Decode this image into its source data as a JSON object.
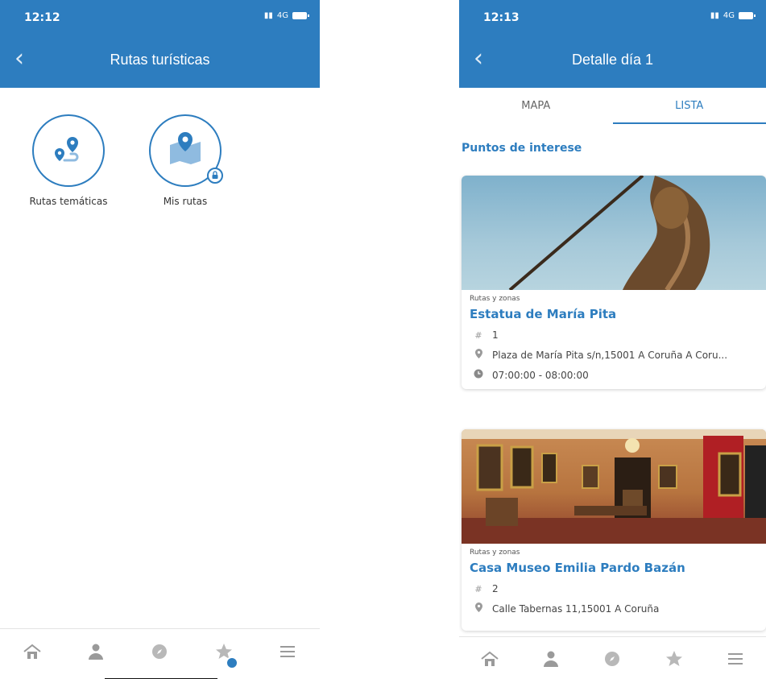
{
  "colors": {
    "primary": "#2d7dbf",
    "icon_gray": "#9a9a9a"
  },
  "screen1": {
    "status": {
      "time": "12:12",
      "network": "4G"
    },
    "header": {
      "title": "Rutas turísticas",
      "back_icon": "chevron-left-icon"
    },
    "tiles": [
      {
        "label": "Rutas temáticas",
        "icon": "route-pins-icon"
      },
      {
        "label": "Mis rutas",
        "icon": "map-pin-icon",
        "badge_icon": "lock-icon"
      }
    ],
    "tabbar": [
      "home-icon",
      "user-icon",
      "compass-icon",
      "star-icon",
      "menu-icon"
    ]
  },
  "screen2": {
    "status": {
      "time": "12:13",
      "network": "4G"
    },
    "header": {
      "title": "Detalle día 1",
      "back_icon": "chevron-left-icon"
    },
    "tabs": [
      {
        "label": "MAPA",
        "active": false
      },
      {
        "label": "LISTA",
        "active": true
      }
    ],
    "section_title": "Puntos de interese",
    "cards": [
      {
        "category": "Rutas y zonas",
        "name": "Estatua de María Pita",
        "number": "1",
        "address": "Plaza de María Pita s/n,15001 A Coruña A Coru...",
        "hours": "07:00:00 - 08:00:00"
      },
      {
        "category": "Rutas y zonas",
        "name": "Casa Museo Emilia Pardo Bazán",
        "number": "2",
        "address": "Calle Tabernas 11,15001 A Coruña"
      }
    ],
    "tabbar": [
      "home-icon",
      "user-icon",
      "compass-icon",
      "star-icon",
      "menu-icon"
    ]
  }
}
